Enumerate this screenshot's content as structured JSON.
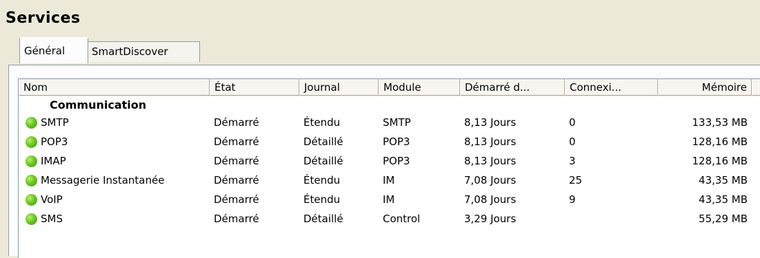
{
  "title": "Services",
  "tabs": [
    {
      "label": "Général",
      "active": true
    },
    {
      "label": "SmartDiscover",
      "active": false
    }
  ],
  "columns": [
    "Nom",
    "État",
    "Journal",
    "Module",
    "Démarré d...",
    "Connexi...",
    "Mémoire"
  ],
  "group": "Communication",
  "status_color": "#5cb81c",
  "rows": [
    {
      "name": "SMTP",
      "state": "Démarré",
      "log": "Étendu",
      "module": "SMTP",
      "started": "8,13 Jours",
      "connections": "0",
      "memory": "133,53 MB"
    },
    {
      "name": "POP3",
      "state": "Démarré",
      "log": "Détaillé",
      "module": "POP3",
      "started": "8,13 Jours",
      "connections": "0",
      "memory": "128,16 MB"
    },
    {
      "name": "IMAP",
      "state": "Démarré",
      "log": "Détaillé",
      "module": "POP3",
      "started": "8,13 Jours",
      "connections": "3",
      "memory": "128,16 MB"
    },
    {
      "name": "Messagerie Instantanée",
      "state": "Démarré",
      "log": "Étendu",
      "module": "IM",
      "started": "7,08 Jours",
      "connections": "25",
      "memory": "43,35 MB"
    },
    {
      "name": "VoIP",
      "state": "Démarré",
      "log": "Étendu",
      "module": "IM",
      "started": "7,08 Jours",
      "connections": "9",
      "memory": "43,35 MB"
    },
    {
      "name": "SMS",
      "state": "Démarré",
      "log": "Détaillé",
      "module": "Control",
      "started": "3,29 Jours",
      "connections": "",
      "memory": "55,29 MB"
    }
  ]
}
